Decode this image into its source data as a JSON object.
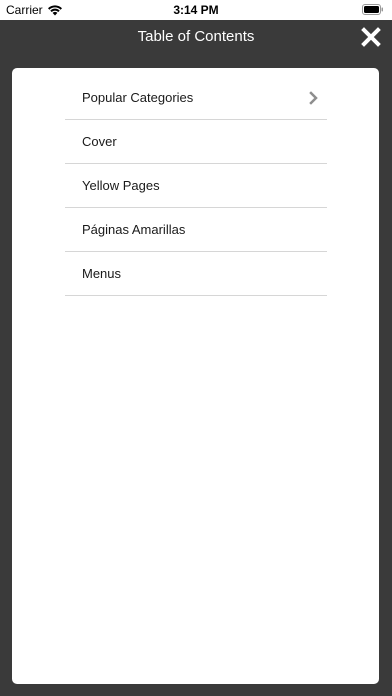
{
  "status_bar": {
    "carrier": "Carrier",
    "time": "3:14 PM"
  },
  "nav": {
    "title": "Table of Contents",
    "close_icon": "close-x-icon"
  },
  "toc": {
    "items": [
      {
        "label": "Popular Categories",
        "has_children": true
      },
      {
        "label": "Cover",
        "has_children": false
      },
      {
        "label": "Yellow Pages",
        "has_children": false
      },
      {
        "label": "Páginas Amarillas",
        "has_children": false
      },
      {
        "label": "Menus",
        "has_children": false
      }
    ]
  },
  "colors": {
    "background": "#3a3a3a",
    "panel": "#ffffff",
    "divider": "#d6d6d6",
    "chevron": "#8e8e8e"
  }
}
